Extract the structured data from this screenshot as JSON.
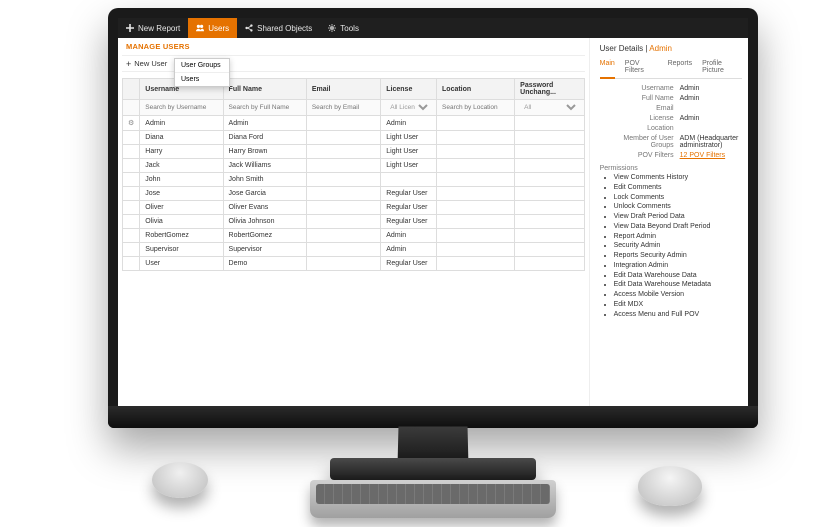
{
  "topnav": {
    "new_report": "New Report",
    "users": "Users",
    "shared_objects": "Shared Objects",
    "tools": "Tools"
  },
  "users_dropdown": {
    "user_groups": "User Groups",
    "users": "Users"
  },
  "subbar": {
    "section_label": "MANAGE USERS",
    "new_user": "New User"
  },
  "table": {
    "headers": {
      "username": "Username",
      "full_name": "Full Name",
      "email": "Email",
      "license": "License",
      "location": "Location",
      "password": "Password Unchang..."
    },
    "search": {
      "username": "Search by Username",
      "full_name": "Search by Full Name",
      "email": "Search by Email",
      "license": "All Licenses",
      "location": "Search by Location",
      "password": "All"
    },
    "rows": [
      {
        "username": "Admin",
        "full_name": "Admin",
        "email": "",
        "license": "Admin",
        "location": "",
        "gear": true
      },
      {
        "username": "Diana",
        "full_name": "Diana Ford",
        "email": "",
        "license": "Light User",
        "location": ""
      },
      {
        "username": "Harry",
        "full_name": "Harry Brown",
        "email": "",
        "license": "Light User",
        "location": ""
      },
      {
        "username": "Jack",
        "full_name": "Jack Williams",
        "email": "",
        "license": "Light User",
        "location": ""
      },
      {
        "username": "John",
        "full_name": "John Smith",
        "email": "",
        "license": "",
        "location": ""
      },
      {
        "username": "Jose",
        "full_name": "Jose Garcia",
        "email": "",
        "license": "Regular User",
        "location": ""
      },
      {
        "username": "Oliver",
        "full_name": "Oliver Evans",
        "email": "",
        "license": "Regular User",
        "location": ""
      },
      {
        "username": "Olivia",
        "full_name": "Olivia Johnson",
        "email": "",
        "license": "Regular User",
        "location": ""
      },
      {
        "username": "RobertGomez",
        "full_name": "RobertGomez",
        "email": "",
        "license": "Admin",
        "location": ""
      },
      {
        "username": "Supervisor",
        "full_name": "Supervisor",
        "email": "",
        "license": "Admin",
        "location": ""
      },
      {
        "username": "User",
        "full_name": "Demo",
        "email": "",
        "license": "Regular User",
        "location": ""
      }
    ]
  },
  "details": {
    "title_prefix": "User Details",
    "title_user": "Admin",
    "tabs": {
      "main": "Main",
      "pov_filters": "POV Filters",
      "reports": "Reports",
      "profile_picture": "Profile Picture"
    },
    "labels": {
      "username": "Username",
      "full_name": "Full Name",
      "email": "Email",
      "license": "License",
      "location": "Location",
      "member_of": "Member of User Groups",
      "pov_filters": "POV Filters"
    },
    "values": {
      "username": "Admin",
      "full_name": "Admin",
      "email": "",
      "license": "Admin",
      "location": "",
      "member_of": "ADM (Headquarter administrator)",
      "pov_filters_link": "12 POV Filters"
    },
    "permissions_label": "Permissions",
    "permissions": [
      "View Comments History",
      "Edit Comments",
      "Lock Comments",
      "Unlock Comments",
      "View Draft Period Data",
      "View Data Beyond Draft Period",
      "Report Admin",
      "Security Admin",
      "Reports Security Admin",
      "Integration Admin",
      "Edit Data Warehouse Data",
      "Edit Data Warehouse Metadata",
      "Access Mobile Version",
      "Edit MDX",
      "Access Menu and Full POV"
    ]
  }
}
